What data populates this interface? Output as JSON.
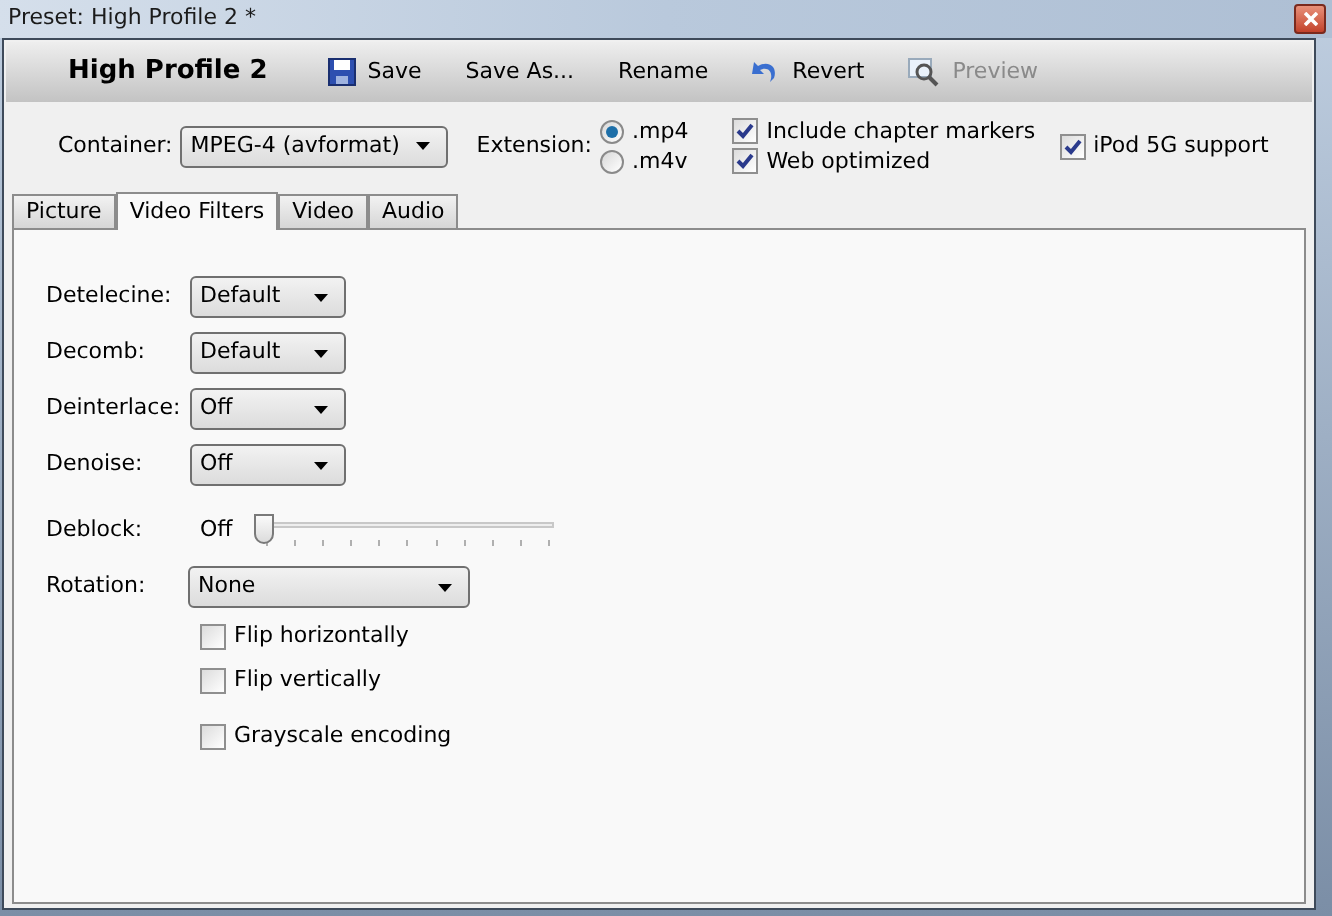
{
  "window": {
    "title": "Preset: High Profile 2 *"
  },
  "toolbar": {
    "title": "High Profile 2",
    "buttons": [
      {
        "kind": "save",
        "label": "Save",
        "disabled": false
      },
      {
        "kind": "plain",
        "label": "Save As...",
        "disabled": false
      },
      {
        "kind": "plain",
        "label": "Rename",
        "disabled": false
      },
      {
        "kind": "revert",
        "label": "Revert",
        "disabled": false
      },
      {
        "kind": "preview",
        "label": "Preview",
        "disabled": true
      }
    ]
  },
  "container": {
    "label": "Container:",
    "value": "MPEG-4 (avformat)"
  },
  "extension": {
    "label": "Extension:",
    "options": [
      {
        "label": ".mp4",
        "selected": true
      },
      {
        "label": ".m4v",
        "selected": false
      }
    ]
  },
  "options": [
    {
      "label": "Include chapter markers",
      "checked": true
    },
    {
      "label": "Web optimized",
      "checked": true
    }
  ],
  "ipod": {
    "label": "iPod 5G support",
    "checked": true
  },
  "tabs": [
    {
      "label": "Picture",
      "selected": false
    },
    {
      "label": "Video Filters",
      "selected": true
    },
    {
      "label": "Video",
      "selected": false
    },
    {
      "label": "Audio",
      "selected": false
    }
  ],
  "filters": [
    {
      "kind": "dropdown",
      "label": "Detelecine:",
      "value": "Default"
    },
    {
      "kind": "dropdown",
      "label": "Decomb:",
      "value": "Default"
    },
    {
      "kind": "dropdown",
      "label": "Deinterlace:",
      "value": "Off"
    },
    {
      "kind": "dropdown",
      "label": "Denoise:",
      "value": "Off"
    },
    {
      "kind": "slider",
      "label": "Deblock:",
      "value": "Off",
      "level": 0
    },
    {
      "kind": "wide-dropdown",
      "label": "Rotation:",
      "value": "None"
    },
    {
      "kind": "checkbox",
      "label": "Flip horizontally",
      "checked": false
    },
    {
      "kind": "checkbox",
      "label": "Flip vertically",
      "checked": false
    },
    {
      "kind": "spaced-checkbox",
      "label": "Grayscale encoding",
      "checked": false
    }
  ]
}
